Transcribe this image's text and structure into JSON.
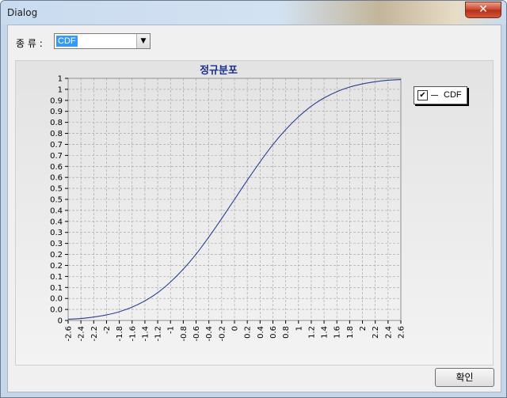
{
  "window": {
    "title": "Dialog",
    "close_label": "✕"
  },
  "controls": {
    "kind_label": "종 류 :",
    "kind_value": "CDF",
    "dropdown_arrow": "▼",
    "ok_label": "확인"
  },
  "legend": {
    "checked_mark": "✔",
    "label": "CDF"
  },
  "colors": {
    "curve": "#2a3f8f",
    "title": "#1a2e8f",
    "grid": "#a0a0a0"
  },
  "chart_data": {
    "type": "line",
    "title": "정규분포",
    "xlabel": "",
    "ylabel": "",
    "grid": true,
    "legend_position": "top-right",
    "xlim": [
      -2.6,
      2.6
    ],
    "ylim": [
      0,
      1
    ],
    "x_ticks": [
      "-2.6",
      "-2.4",
      "-2.2",
      "-2",
      "-1.8",
      "-1.6",
      "-1.4",
      "-1.2",
      "-1",
      "-0.8",
      "-0.6",
      "-0.4",
      "-0.2",
      "0",
      "0.2",
      "0.4",
      "0.6",
      "0.8",
      "1",
      "1.2",
      "1.4",
      "1.6",
      "1.8",
      "2",
      "2.2",
      "2.4",
      "2.6"
    ],
    "y_ticks": [
      "0",
      "0.0",
      "0.0",
      "0.1",
      "0.1",
      "0.2",
      "0.2",
      "0.3",
      "0.3",
      "0.4",
      "0.4",
      "0.5",
      "0.5",
      "0.6",
      "0.6",
      "0.7",
      "0.7",
      "0.8",
      "0.8",
      "0.9",
      "0.9",
      "1",
      "1"
    ],
    "series": [
      {
        "name": "CDF",
        "x": [
          -2.6,
          -2.4,
          -2.2,
          -2.0,
          -1.8,
          -1.6,
          -1.4,
          -1.2,
          -1.0,
          -0.8,
          -0.6,
          -0.4,
          -0.2,
          0.0,
          0.2,
          0.4,
          0.6,
          0.8,
          1.0,
          1.2,
          1.4,
          1.6,
          1.8,
          2.0,
          2.2,
          2.4,
          2.6
        ],
        "y": [
          0.005,
          0.008,
          0.014,
          0.023,
          0.036,
          0.055,
          0.081,
          0.115,
          0.159,
          0.212,
          0.274,
          0.345,
          0.421,
          0.5,
          0.579,
          0.655,
          0.726,
          0.788,
          0.841,
          0.885,
          0.919,
          0.945,
          0.964,
          0.977,
          0.986,
          0.992,
          0.995
        ]
      }
    ]
  }
}
